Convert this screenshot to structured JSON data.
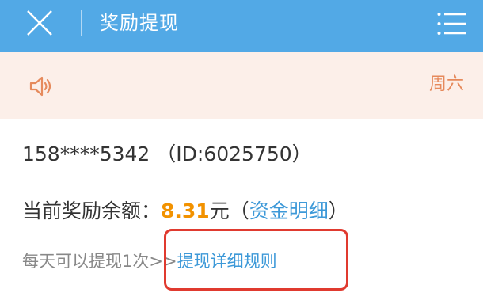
{
  "header": {
    "title": "奖励提现",
    "close_icon": "close-icon",
    "menu_icon": "menu-icon",
    "color": "#52a9e6"
  },
  "notice": {
    "icon": "speaker-icon",
    "day": "周六",
    "color": "#e68a5c"
  },
  "account": {
    "text": "158****5342 （ID:6025750）"
  },
  "balance": {
    "label": "当前奖励余额：",
    "amount": "8.31",
    "unit": "元",
    "paren_open": "（",
    "detail_link": "资金明细",
    "paren_close": "）"
  },
  "withdraw": {
    "limit_text": "每天可以提现1次",
    "arrow": ">>",
    "rules_link": "提现详细规则"
  }
}
